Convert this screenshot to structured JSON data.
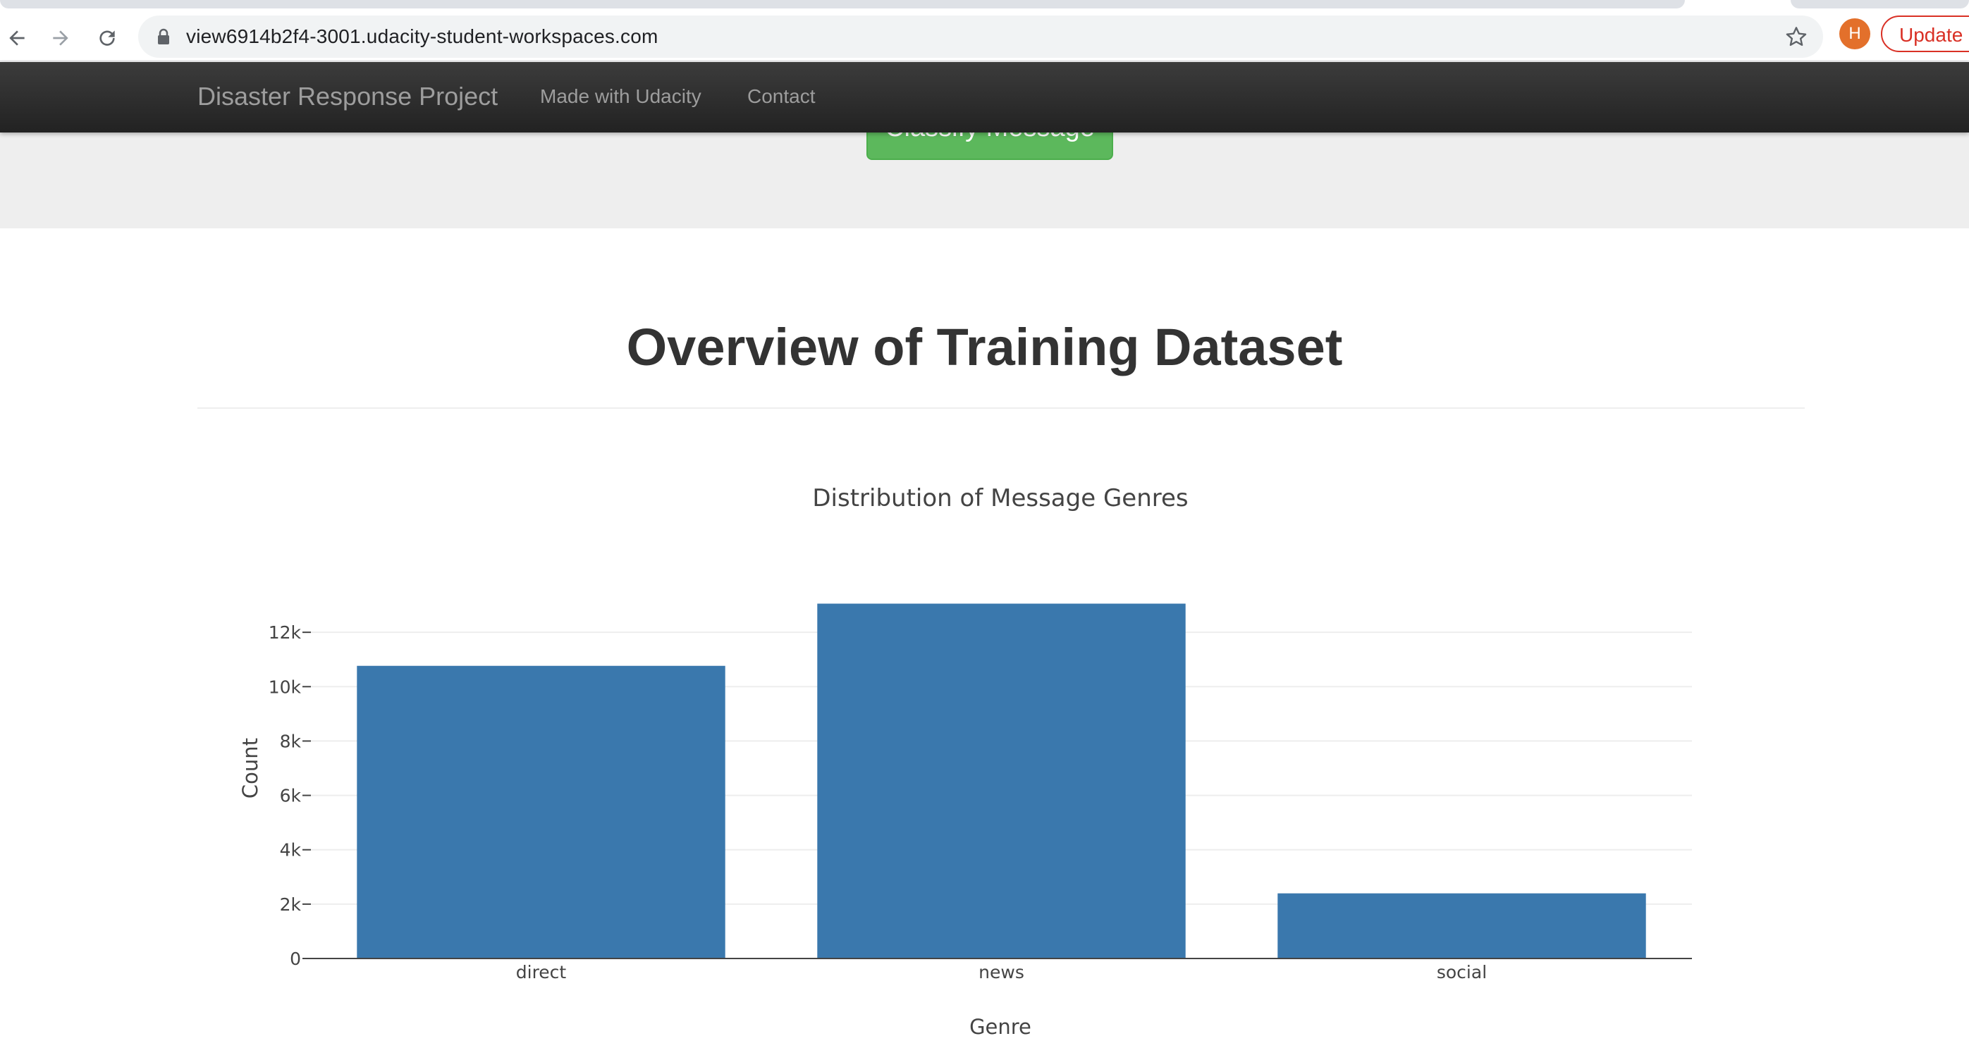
{
  "browser": {
    "url": "view6914b2f4-3001.udacity-student-workspaces.com",
    "profile_initial": "H",
    "update_label": "Update",
    "icons": [
      "back-arrow-icon",
      "forward-arrow-icon",
      "reload-icon",
      "lock-icon",
      "star-icon"
    ]
  },
  "navbar": {
    "brand": "Disaster Response Project",
    "links": [
      "Made with Udacity",
      "Contact"
    ]
  },
  "jumbotron": {
    "classify_button": "Classify Message"
  },
  "section": {
    "heading": "Overview of Training Dataset"
  },
  "colors": {
    "bar": "#3a78ad",
    "navbar": "#222222",
    "classify_button": "#5cb85c",
    "update": "#d93025",
    "avatar": "#e3702b"
  },
  "chart_data": {
    "type": "bar",
    "title": "Distribution of Message Genres",
    "xlabel": "Genre",
    "ylabel": "Count",
    "categories": [
      "direct",
      "news",
      "social"
    ],
    "values": [
      10766,
      13054,
      2396
    ],
    "ylim": [
      0,
      13741
    ],
    "yticks": [
      0,
      2000,
      4000,
      6000,
      8000,
      10000,
      12000
    ],
    "ytick_labels": [
      "0",
      "2k",
      "4k",
      "6k",
      "8k",
      "10k",
      "12k"
    ],
    "grid": true,
    "legend": "none"
  }
}
